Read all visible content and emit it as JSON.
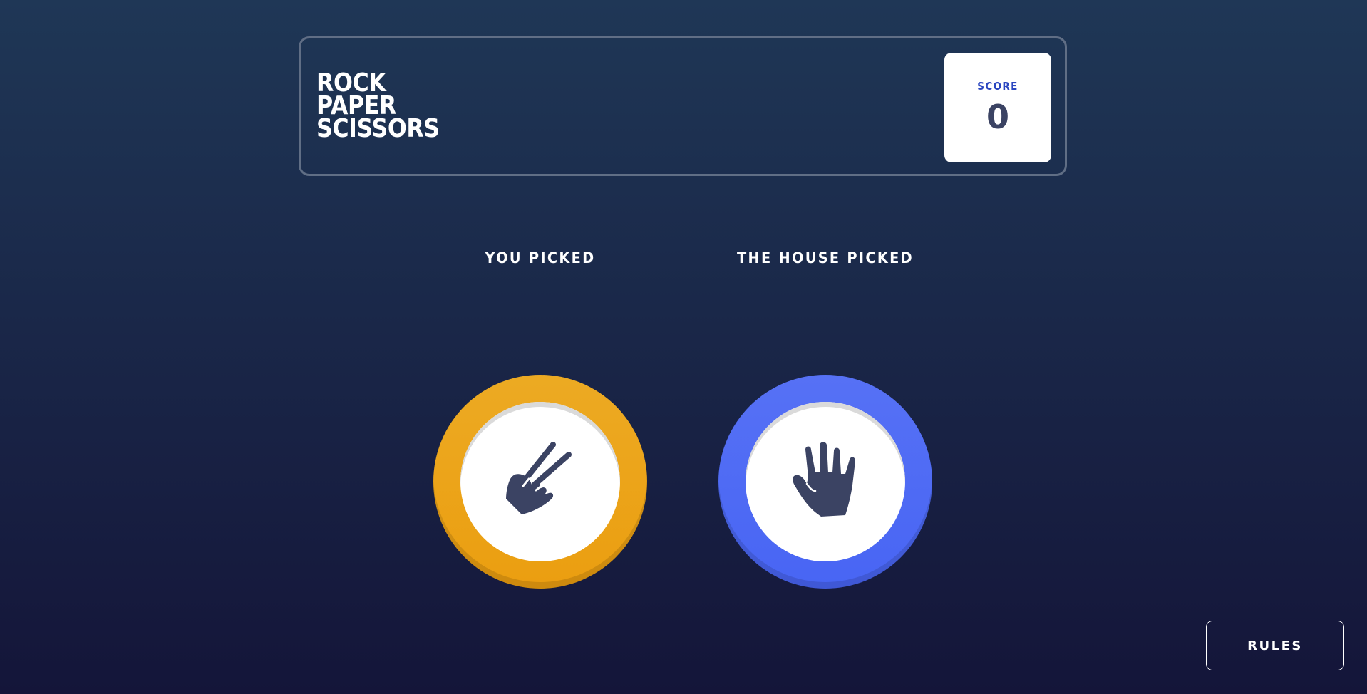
{
  "header": {
    "title_lines": [
      "ROCK",
      "PAPER",
      "SCISSORS"
    ],
    "score_label": "SCORE",
    "score_value": "0"
  },
  "game": {
    "you_picked_label": "YOU PICKED",
    "house_picked_label": "THE HOUSE PICKED",
    "player_choice": {
      "name": "scissors",
      "icon": "scissors-hand-icon",
      "color": "#eca922"
    },
    "house_choice": {
      "name": "paper",
      "icon": "paper-hand-icon",
      "color": "#4865f4"
    }
  },
  "footer": {
    "rules_label": "RULES"
  },
  "colors": {
    "background_top": "#1f3756",
    "background_bottom": "#141539",
    "header_outline": "#606e85",
    "score_text": "#2a46c0",
    "dark_text": "#3b4363"
  }
}
